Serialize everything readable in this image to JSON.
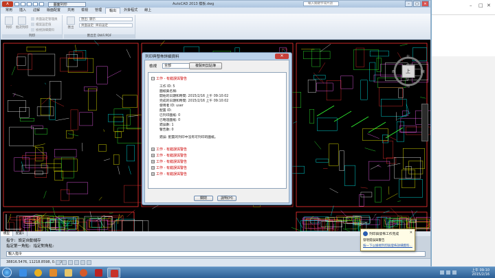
{
  "app": {
    "title": "AutoCAD 2013  模板.dwg",
    "drawing_name": "ㅤ圖面列印",
    "search_placeholder": "輸入關鍵字或片語"
  },
  "window_controls": [
    "–",
    "□",
    "✕"
  ],
  "ribbon": {
    "app_button": "A",
    "tabs": [
      "常用",
      "插入",
      "註解",
      "版面配置",
      "共用",
      "檢視",
      "管理",
      "輸出",
      "外掛程式",
      "線上"
    ],
    "active_tab_index": 7,
    "groups": [
      {
        "label": "列印",
        "buttons": [
          "列印",
          "批次列印",
          "出圖樣式"
        ],
        "rows": [
          "頁面設定管理員",
          "檔案設定值",
          "檢視詳細資料"
        ]
      },
      {
        "label": "匯出至 DWF/PDF",
        "buttons": [
          "匯出"
        ],
        "rows": [
          "匯出: 顯示",
          "頁面設定: 目前設定"
        ]
      }
    ]
  },
  "dialog": {
    "title": "列印與發佈詳細資料",
    "close": "✕",
    "filter_label": "檢視",
    "filter_value": "全部",
    "copy_button": "複製到剪貼簿",
    "expanded_job": {
      "header": "工作 - 有錯誤與警告",
      "fields": [
        "工作 ID: 5",
        "圖紙集名稱:",
        "開始的日期和時間: 2015/2/16 上午 09:10:02",
        "完成的日期和時間: 2015/2/16 上午 09:10:02",
        "使用者 ID: user",
        "配置 ID:",
        "已列印圖紙: 0",
        "已略過圖紙: 0",
        "錯誤數: 1",
        "警告數: 0"
      ],
      "message": "錯誤: 配置的列印中沒有可列印的圖紙。"
    },
    "collapsed_jobs": [
      "工作 - 有錯誤與警告",
      "工作 - 有錯誤與警告",
      "工作 - 有錯誤與警告",
      "工作 - 有錯誤與警告",
      "工作 - 有錯誤與警告"
    ],
    "close_button": "關閉",
    "help_button": "說明(H)"
  },
  "command": {
    "lines": [
      "指令: 設定自動儲存",
      "指定第一角點: 指定對角點:"
    ],
    "prompt": "輸入指令"
  },
  "layout_tabs": [
    "模型",
    "配置1"
  ],
  "status": {
    "coordinates": "38816.5476, 11218.8598, 0.0000"
  },
  "notification": {
    "title": "列印與發佈工作完成",
    "body": "發現錯誤與警告",
    "link": "按一下以檢視列印與發佈詳細資料...",
    "close": "✕"
  },
  "nav_cube": {
    "top": "上",
    "north": "北",
    "south": "南",
    "east": "東",
    "west": "西"
  },
  "taskbar": {
    "time": "上午 09:10",
    "date": "2015/2/16",
    "icons": [
      "ie-icon",
      "chrome-icon",
      "media-icon",
      "explorer-icon",
      "firefox-icon",
      "app-icon",
      "autocad-icon"
    ]
  },
  "colors": {
    "error": "#cc0000",
    "accent": "#1f6b4a",
    "taskbar": "#2d5f95"
  }
}
